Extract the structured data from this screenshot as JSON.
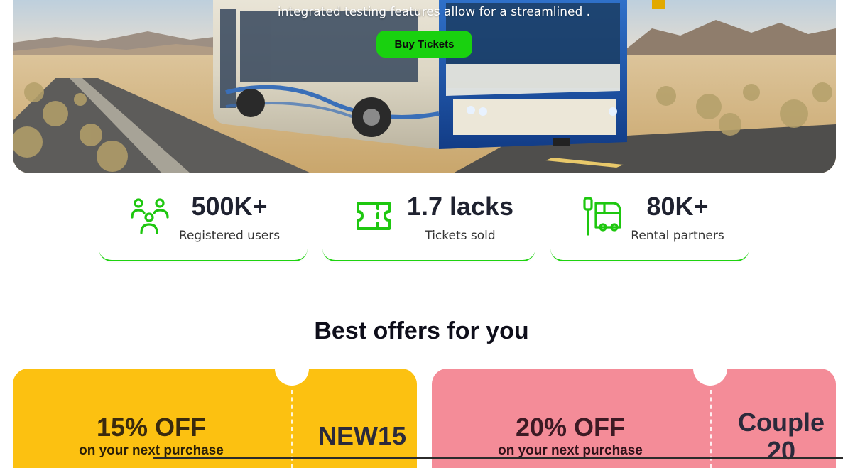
{
  "hero": {
    "text": "integrated testing features allow for a streamlined .",
    "cta_label": "Buy Tickets"
  },
  "stats": [
    {
      "value": "500K+",
      "label": "Registered users",
      "icon": "users-icon"
    },
    {
      "value": "1.7 lacks",
      "label": "Tickets sold",
      "icon": "ticket-icon"
    },
    {
      "value": "80K+",
      "label": "Rental partners",
      "icon": "bus-stop-icon"
    }
  ],
  "offers": {
    "title": "Best offers for you",
    "coupons": [
      {
        "discount": "15% OFF",
        "subtitle": "on your next purchase",
        "code": "NEW15",
        "color": "#fcc111"
      },
      {
        "discount": "20% OFF",
        "subtitle": "on your next purchase",
        "code": "Couple 20",
        "color": "#f48c98"
      }
    ]
  },
  "colors": {
    "accent": "#19d10f",
    "text_dark": "#1f2230"
  }
}
